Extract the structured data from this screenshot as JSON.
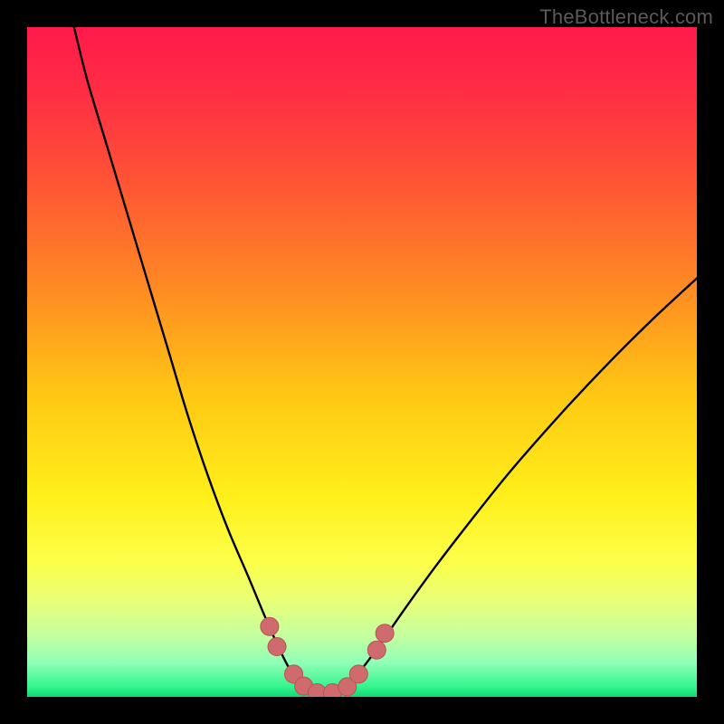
{
  "watermark": "TheBottleneck.com",
  "chart_data": {
    "type": "line",
    "title": "",
    "xlabel": "",
    "ylabel": "",
    "xlim": [
      0,
      100
    ],
    "ylim": [
      0,
      100
    ],
    "grid": false,
    "legend": false,
    "gradient_stops": [
      {
        "offset": 0.0,
        "color": "#ff1a4b"
      },
      {
        "offset": 0.1,
        "color": "#ff2e44"
      },
      {
        "offset": 0.25,
        "color": "#ff5a32"
      },
      {
        "offset": 0.4,
        "color": "#ff8e22"
      },
      {
        "offset": 0.55,
        "color": "#ffc814"
      },
      {
        "offset": 0.7,
        "color": "#ffef1a"
      },
      {
        "offset": 0.8,
        "color": "#fcff4a"
      },
      {
        "offset": 0.86,
        "color": "#e7ff7a"
      },
      {
        "offset": 0.91,
        "color": "#c3ffa0"
      },
      {
        "offset": 0.95,
        "color": "#8fffb6"
      },
      {
        "offset": 0.985,
        "color": "#33f58e"
      },
      {
        "offset": 1.0,
        "color": "#0fd873"
      }
    ],
    "series": [
      {
        "name": "left-curve",
        "stroke": "#000000",
        "stroke_width": 2.4,
        "points": [
          {
            "x": 7.0,
            "y": 100.0
          },
          {
            "x": 9.0,
            "y": 92.0
          },
          {
            "x": 12.0,
            "y": 82.0
          },
          {
            "x": 15.0,
            "y": 72.0
          },
          {
            "x": 18.0,
            "y": 62.0
          },
          {
            "x": 21.0,
            "y": 52.0
          },
          {
            "x": 24.0,
            "y": 42.0
          },
          {
            "x": 27.0,
            "y": 33.0
          },
          {
            "x": 30.0,
            "y": 25.0
          },
          {
            "x": 33.0,
            "y": 18.0
          },
          {
            "x": 35.5,
            "y": 12.0
          },
          {
            "x": 37.5,
            "y": 7.5
          },
          {
            "x": 39.0,
            "y": 4.5
          },
          {
            "x": 40.3,
            "y": 2.6
          },
          {
            "x": 41.5,
            "y": 1.4
          },
          {
            "x": 43.0,
            "y": 0.6
          },
          {
            "x": 44.5,
            "y": 0.3
          }
        ]
      },
      {
        "name": "right-curve",
        "stroke": "#000000",
        "stroke_width": 2.4,
        "points": [
          {
            "x": 44.5,
            "y": 0.3
          },
          {
            "x": 46.0,
            "y": 0.6
          },
          {
            "x": 47.5,
            "y": 1.5
          },
          {
            "x": 49.0,
            "y": 3.0
          },
          {
            "x": 51.0,
            "y": 5.5
          },
          {
            "x": 53.5,
            "y": 9.0
          },
          {
            "x": 57.0,
            "y": 14.0
          },
          {
            "x": 61.0,
            "y": 19.5
          },
          {
            "x": 66.0,
            "y": 26.0
          },
          {
            "x": 72.0,
            "y": 33.5
          },
          {
            "x": 79.0,
            "y": 41.5
          },
          {
            "x": 86.0,
            "y": 49.0
          },
          {
            "x": 93.0,
            "y": 56.0
          },
          {
            "x": 100.0,
            "y": 62.5
          }
        ]
      }
    ],
    "markers": {
      "name": "trough-markers",
      "fill": "#cf6b6e",
      "stroke": "#b75356",
      "radius": 10,
      "points": [
        {
          "x": 36.2,
          "y": 10.5
        },
        {
          "x": 37.3,
          "y": 7.5
        },
        {
          "x": 39.8,
          "y": 3.4
        },
        {
          "x": 41.3,
          "y": 1.6
        },
        {
          "x": 43.3,
          "y": 0.6
        },
        {
          "x": 45.6,
          "y": 0.6
        },
        {
          "x": 47.8,
          "y": 1.5
        },
        {
          "x": 49.5,
          "y": 3.4
        },
        {
          "x": 52.2,
          "y": 7.0
        },
        {
          "x": 53.4,
          "y": 9.5
        }
      ]
    }
  }
}
